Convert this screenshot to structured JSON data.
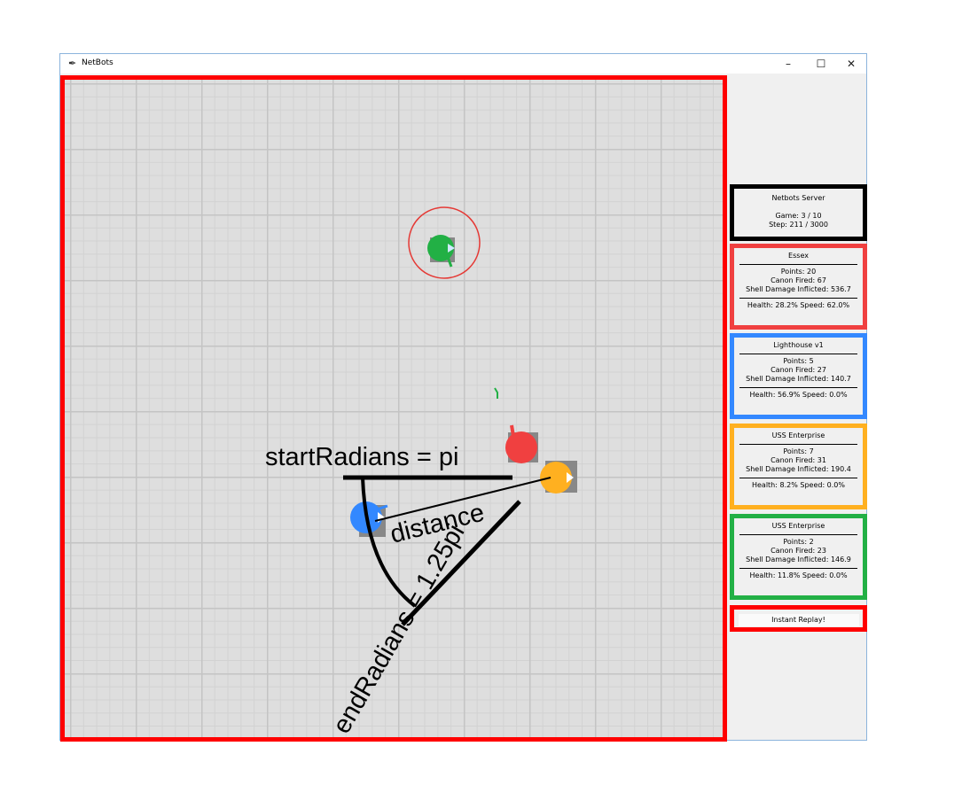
{
  "window": {
    "title": "NetBots",
    "minimize": "–",
    "maximize": "☐",
    "close": "✕"
  },
  "annotations": {
    "start": "startRadians = pi",
    "distance": "distance",
    "end": "endRadians = 1.25pi"
  },
  "server": {
    "title": "Netbots Server",
    "game": "Game: 3 / 10",
    "step": "Step: 211 / 3000"
  },
  "bots": [
    {
      "name": "Essex",
      "points": "Points: 20",
      "canon": "Canon Fired: 67",
      "damage": "Shell Damage Inflicted: 536.7",
      "status": "Health: 28.2%   Speed: 62.0%",
      "color": "#f04040"
    },
    {
      "name": "Lighthouse v1",
      "points": "Points: 5",
      "canon": "Canon Fired: 27",
      "damage": "Shell Damage Inflicted: 140.7",
      "status": "Health: 56.9%   Speed: 0.0%",
      "color": "#3388ff"
    },
    {
      "name": "USS Enterprise",
      "points": "Points: 7",
      "canon": "Canon Fired: 31",
      "damage": "Shell Damage Inflicted: 190.4",
      "status": "Health: 8.2%   Speed: 0.0%",
      "color": "#ffb020"
    },
    {
      "name": "USS Enterprise",
      "points": "Points: 2",
      "canon": "Canon Fired: 23",
      "damage": "Shell Damage Inflicted: 146.9",
      "status": "Health: 11.8%   Speed: 0.0%",
      "color": "#22b045"
    }
  ],
  "replay": {
    "label": "Instant Replay!"
  }
}
